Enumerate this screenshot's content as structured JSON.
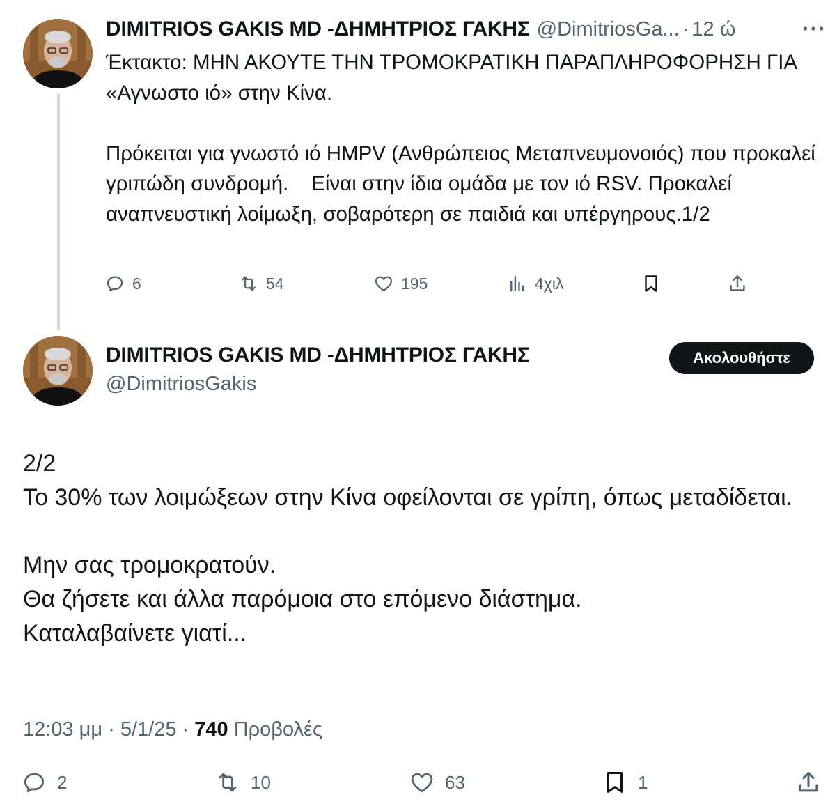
{
  "tweet1": {
    "author_name": "DIMITRIOS GAKIS MD -ΔΗΜΗΤΡΙΟΣ ΓΑΚΗΣ",
    "handle": "@DimitriosGa...",
    "separator": "·",
    "time": "12 ώ",
    "more_label": "···",
    "body": "Έκτακτο: ΜΗΝ ΑΚΟΥΤΕ ΤΗΝ ΤΡΟΜΟΚΡΑΤΙΚΗ ΠΑΡΑΠΛΗΡΟΦΟΡΗΣΗ ΓΙΑ «Αγνωστο ιό» στην Κίνα.\n\nΠρόκειται για γνωστό ιό HMPV (Ανθρώπειος Μεταπνευμονοιός) που προκαλεί γριπώδη συνδρομή.    Είναι στην ίδια ομάδα με τον ιό RSV. Προκαλεί αναπνευστική λοίμωξη, σοβαρότερη σε παιδιά και υπέργηρους.1/2",
    "actions": {
      "replies": "6",
      "reposts": "54",
      "likes": "195",
      "views": "4χιλ"
    }
  },
  "tweet2": {
    "author_name": "DIMITRIOS GAKIS MD -ΔΗΜΗΤΡΙΟΣ ΓΑΚΗΣ",
    "handle": "@DimitriosGakis",
    "follow_label": "Ακολουθήστε",
    "body": "2/2\nΤο 30% των λοιμώξεων στην Κίνα οφείλονται σε γρίπη, όπως μεταδίδεται.\n\nΜην σας τρομοκρατούν.\nΘα ζήσετε και άλλα παρόμοια στο επόμενο διάστημα.\nΚαταλαβαίνετε γιατί...",
    "meta": {
      "time": "12:03 μμ",
      "date": "5/1/25",
      "separator": "·",
      "views_count": "740",
      "views_label": "Προβολές"
    },
    "actions": {
      "replies": "2",
      "reposts": "10",
      "likes": "63",
      "bookmarks": "1"
    }
  },
  "icons": {
    "reply": "reply-icon",
    "repost": "repost-icon",
    "like": "heart-icon",
    "views": "views-icon",
    "bookmark": "bookmark-icon",
    "share": "share-icon"
  },
  "colors": {
    "text_primary": "#0f1419",
    "text_secondary": "#536471",
    "thread_line": "#cfd9de",
    "button_bg": "#0f1419"
  }
}
